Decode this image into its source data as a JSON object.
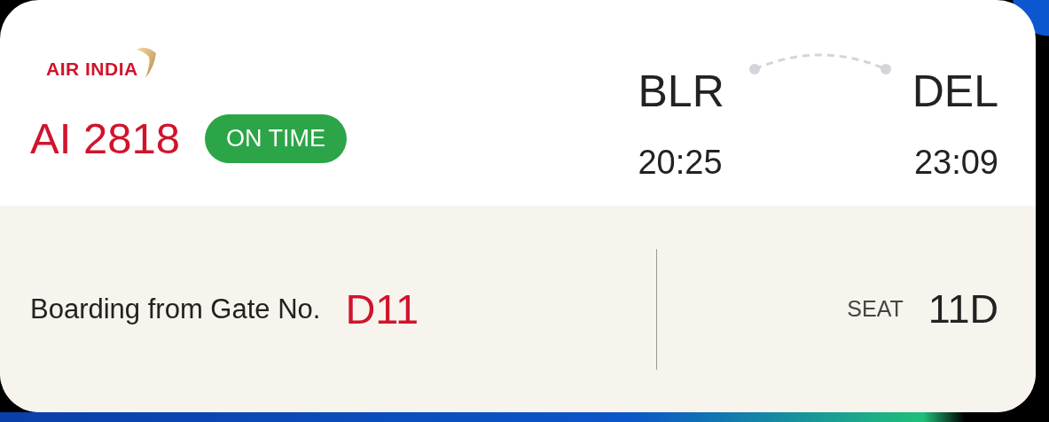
{
  "airline": {
    "name": "AIR INDIA"
  },
  "flight": {
    "number": "AI 2818",
    "status": {
      "label": "ON TIME",
      "kind": "on_time"
    }
  },
  "route": {
    "origin": {
      "code": "BLR",
      "time": "20:25"
    },
    "destination": {
      "code": "DEL",
      "time": "23:09"
    }
  },
  "boarding": {
    "label": "Boarding from Gate No.",
    "gate": "D11"
  },
  "seat": {
    "label": "SEAT",
    "value": "11D"
  }
}
